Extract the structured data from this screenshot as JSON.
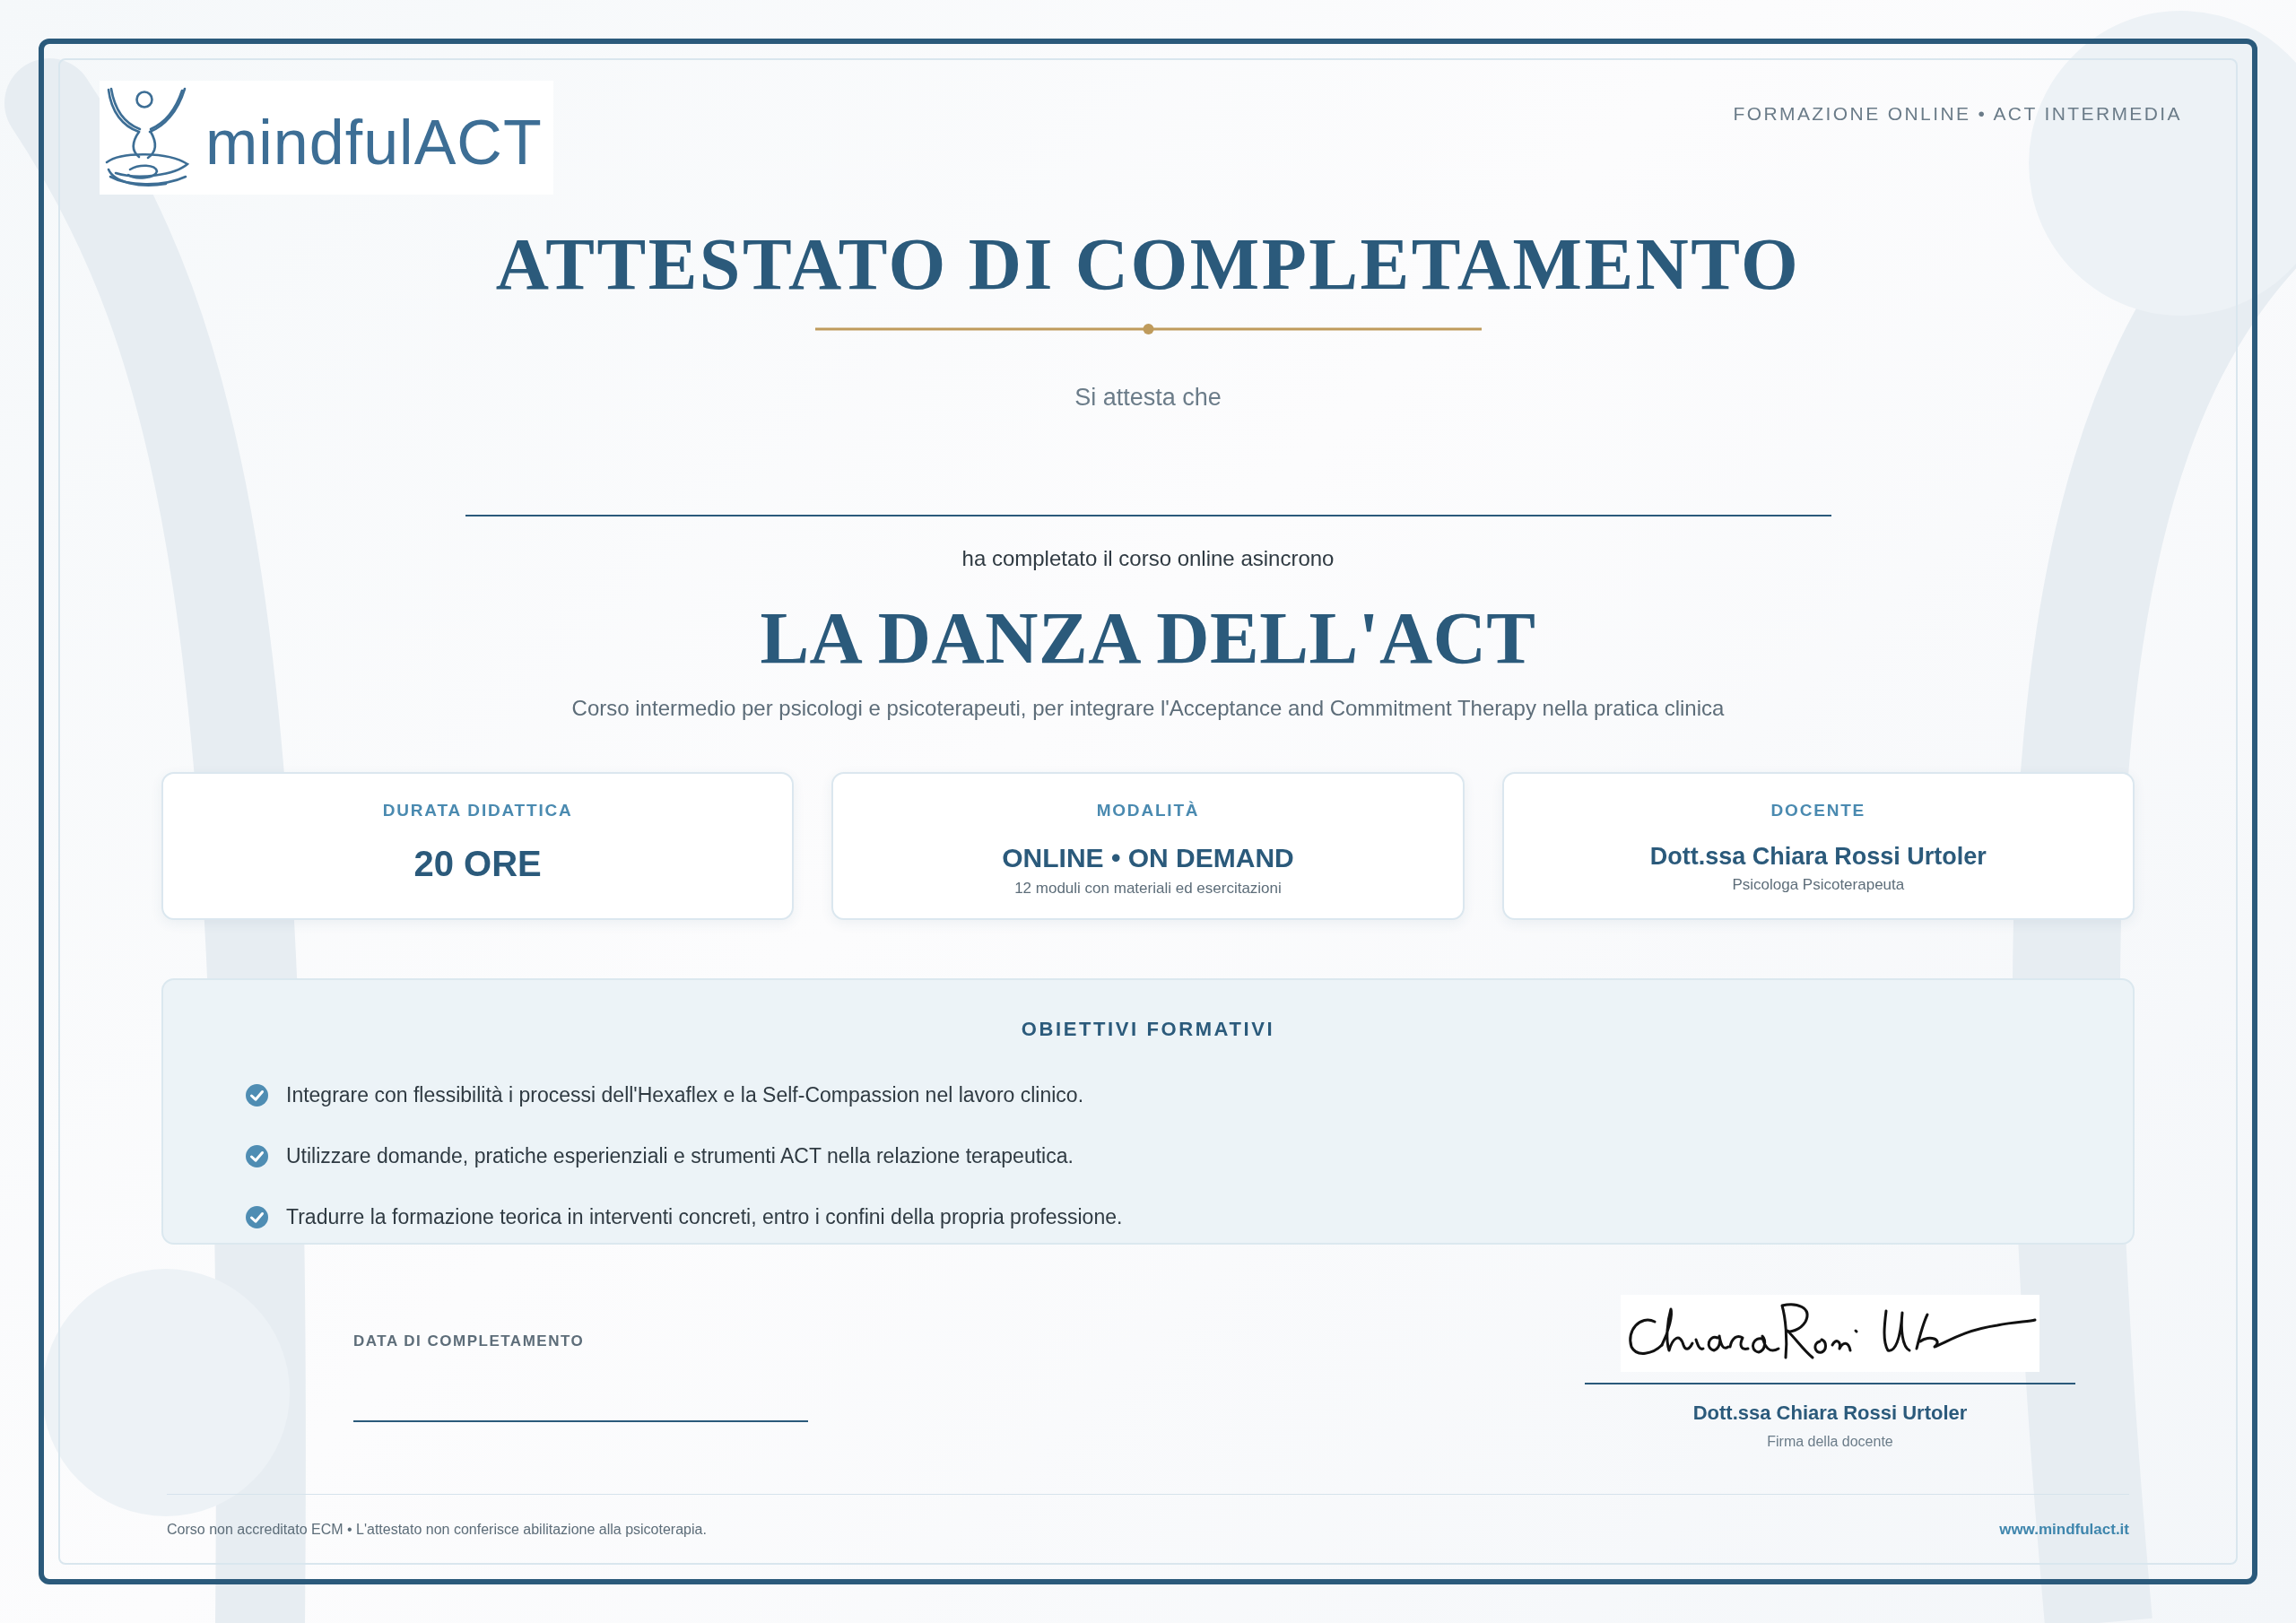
{
  "header": {
    "logo_text": "mindfulACT",
    "tagline": "FORMAZIONE ONLINE • ACT INTERMEDIA"
  },
  "title": "ATTESTATO DI COMPLETAMENTO",
  "intro": "Si attesta che",
  "completion_text": "ha completato il corso online asincrono",
  "course": {
    "title": "LA DANZA DELL'ACT",
    "description": "Corso intermedio per psicologi e psicoterapeuti, per integrare l'Acceptance and Commitment Therapy nella pratica clinica"
  },
  "info_cards": [
    {
      "kind": "figure",
      "label": "DURATA DIDATTICA",
      "value": "20 ORE"
    },
    {
      "kind": "text",
      "label": "MODALITÀ",
      "value": "ONLINE • ON DEMAND",
      "note": "12 moduli con materiali ed esercitazioni"
    },
    {
      "kind": "person",
      "label": "DOCENTE",
      "value": "Dott.ssa Chiara Rossi Urtoler",
      "note": "Psicologa Psicoterapeuta"
    }
  ],
  "objectives": {
    "title": "OBIETTIVI FORMATIVI",
    "items": [
      "Integrare con flessibilità i processi dell'Hexaflex e la Self-Compassion nel lavoro clinico.",
      "Utilizzare domande, pratiche esperienziali e strumenti ACT nella relazione terapeutica.",
      "Tradurre la formazione teorica in interventi concreti, entro i confini della propria professione."
    ]
  },
  "completion_date": {
    "label": "DATA DI COMPLETAMENTO"
  },
  "signature": {
    "name": "Dott.ssa Chiara Rossi Urtoler",
    "caption": "Firma della docente"
  },
  "footer": {
    "disclaimer": "Corso non accreditato ECM • L'attestato non conferisce abilitazione alla psicoterapia.",
    "website": "www.mindfulact.it"
  }
}
